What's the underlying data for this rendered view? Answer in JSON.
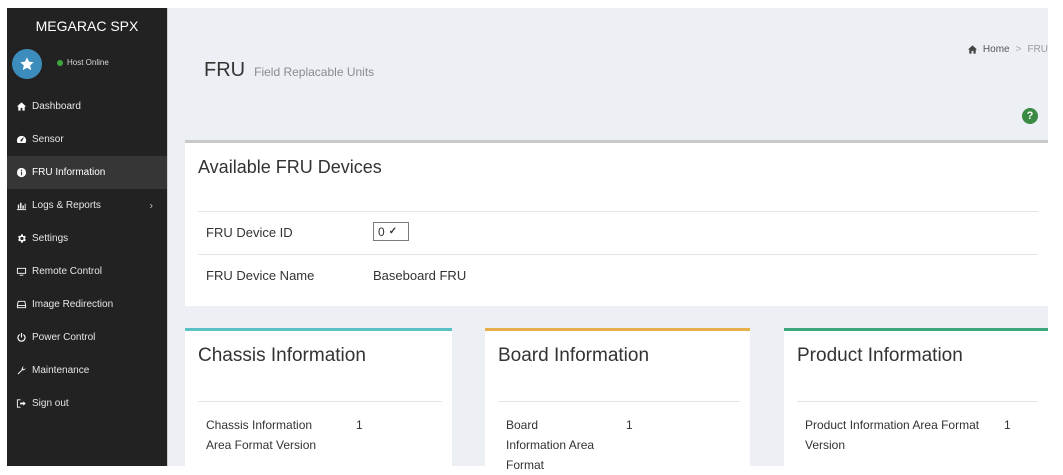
{
  "sidebar": {
    "brand": "MEGARAC SPX",
    "status": "Host Online",
    "items": [
      {
        "label": "Dashboard",
        "icon": "home-icon"
      },
      {
        "label": "Sensor",
        "icon": "gauge-icon"
      },
      {
        "label": "FRU Information",
        "icon": "info-icon",
        "active": true
      },
      {
        "label": "Logs & Reports",
        "icon": "bar-chart-icon",
        "chevron": "›"
      },
      {
        "label": "Settings",
        "icon": "gear-icon"
      },
      {
        "label": "Remote Control",
        "icon": "monitor-icon"
      },
      {
        "label": "Image Redirection",
        "icon": "drive-icon"
      },
      {
        "label": "Power Control",
        "icon": "power-icon"
      },
      {
        "label": "Maintenance",
        "icon": "wrench-icon"
      },
      {
        "label": "Sign out",
        "icon": "sign-out-icon"
      }
    ]
  },
  "header": {
    "title": "FRU",
    "subtitle": "Field Replacable Units",
    "breadcrumb": {
      "home": "Home",
      "separator": ">",
      "current": "FRU"
    },
    "help": "?"
  },
  "fru": {
    "heading": "Available FRU Devices",
    "device_id_label": "FRU Device ID",
    "device_id_value": "0",
    "device_name_label": "FRU Device Name",
    "device_name_value": "Baseboard FRU"
  },
  "cards": {
    "chassis": {
      "title": "Chassis Information",
      "field_label": "Chassis Information Area Format Version",
      "field_value": "1"
    },
    "board": {
      "title": "Board Information",
      "field_label": "Board Information Area Format",
      "field_value": "1"
    },
    "product": {
      "title": "Product Information",
      "field_label": "Product Information Area Format Version",
      "field_value": "1"
    }
  },
  "colors": {
    "sidebar_bg": "#222222",
    "active_item_bg": "#363636",
    "avatar": "#3c8dbc",
    "status_online": "#3fa63f",
    "chassis_accent": "#5bc0c4",
    "board_accent": "#e8b04a",
    "product_accent": "#3aa67a",
    "help": "#3a8a44"
  }
}
